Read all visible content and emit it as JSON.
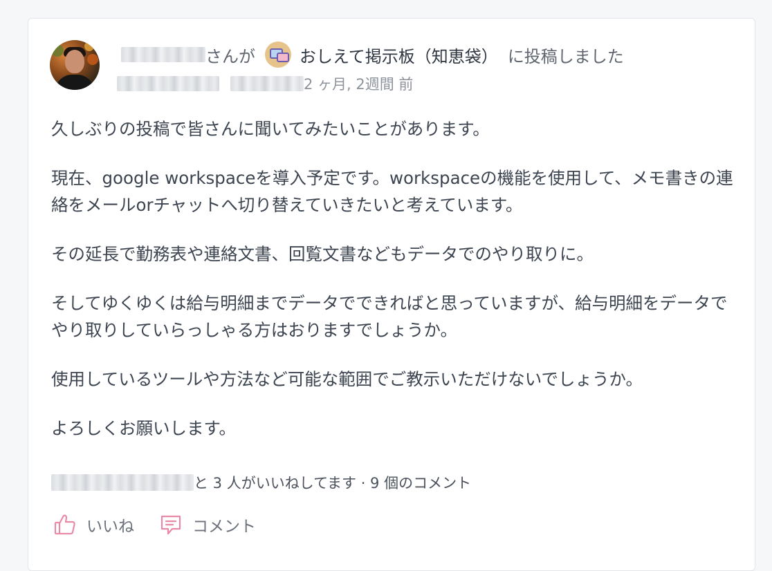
{
  "post": {
    "author_suffix": "さんが",
    "group_name": "おしえて掲示板（知恵袋）",
    "action_text": "に投稿しました",
    "time_ago": "2 ヶ月, 2週間 前",
    "paragraphs": [
      "久しぶりの投稿で皆さんに聞いてみたいことがあります。",
      "現在、google workspaceを導入予定です。workspaceの機能を使用して、メモ書きの連絡をメールorチャットへ切り替えていきたいと考えています。",
      "その延長で勤務表や連絡文書、回覧文書などもデータでのやり取りに。",
      "そしてゆくゆくは給与明細までデータでできればと思っていますが、給与明細をデータでやり取りしていらっしゃる方はおりますでしょうか。",
      "使用しているツールや方法など可能な範囲でご教示いただけないでしょうか。",
      "よろしくお願いします。"
    ],
    "likes_text": "と 3 人がいいねしてます · 9 個のコメント"
  },
  "actions": {
    "like_label": "いいね",
    "comment_label": "コメント"
  },
  "colors": {
    "accent_icon": "#e88aa6",
    "text": "#3c4450",
    "muted": "#8c939c"
  },
  "icons": {
    "like": "thumbs-up-icon",
    "comment": "comment-icon",
    "group": "speech-bubbles-icon"
  }
}
